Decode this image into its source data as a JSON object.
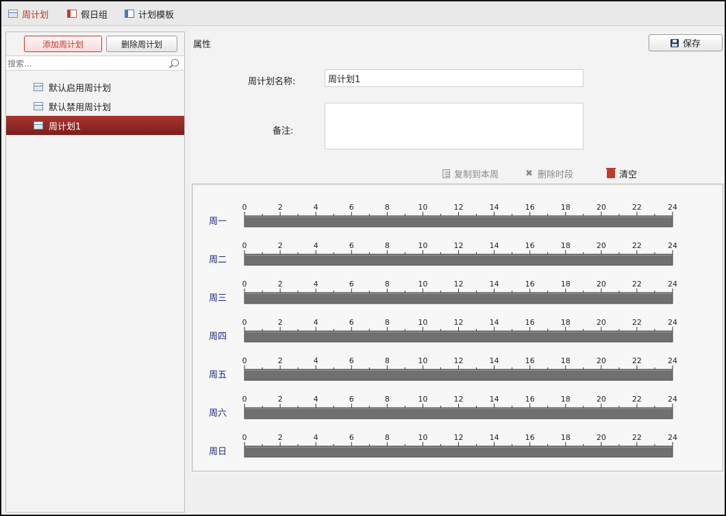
{
  "tabs": [
    {
      "label": "周计划",
      "icon": "calendar-icon",
      "active": true
    },
    {
      "label": "假日组",
      "icon": "holiday-icon",
      "active": false
    },
    {
      "label": "计划模板",
      "icon": "template-icon",
      "active": false
    }
  ],
  "sidebar": {
    "add_label": "添加周计划",
    "delete_label": "删除周计划",
    "search_placeholder": "搜索...",
    "items": [
      {
        "label": "默认启用周计划",
        "selected": false
      },
      {
        "label": "默认禁用周计划",
        "selected": false
      },
      {
        "label": "周计划1",
        "selected": true
      }
    ]
  },
  "main": {
    "title": "属性",
    "save_label": "保存",
    "name_label": "周计划名称:",
    "name_value": "周计划1",
    "note_label": "备注:",
    "note_value": "",
    "toolbar": {
      "copy_label": "复制到本周",
      "delete_period_label": "删除时段",
      "clear_label": "清空"
    },
    "days": [
      "周一",
      "周二",
      "周三",
      "周四",
      "周五",
      "周六",
      "周日"
    ],
    "hour_ticks": [
      "0",
      "2",
      "4",
      "6",
      "8",
      "10",
      "12",
      "14",
      "16",
      "18",
      "20",
      "22",
      "24"
    ]
  },
  "colors": {
    "accent": "#c0392b",
    "selected_row": "#8a2a26",
    "timeline_bar": "#707070",
    "day_label": "#1a2a80"
  }
}
